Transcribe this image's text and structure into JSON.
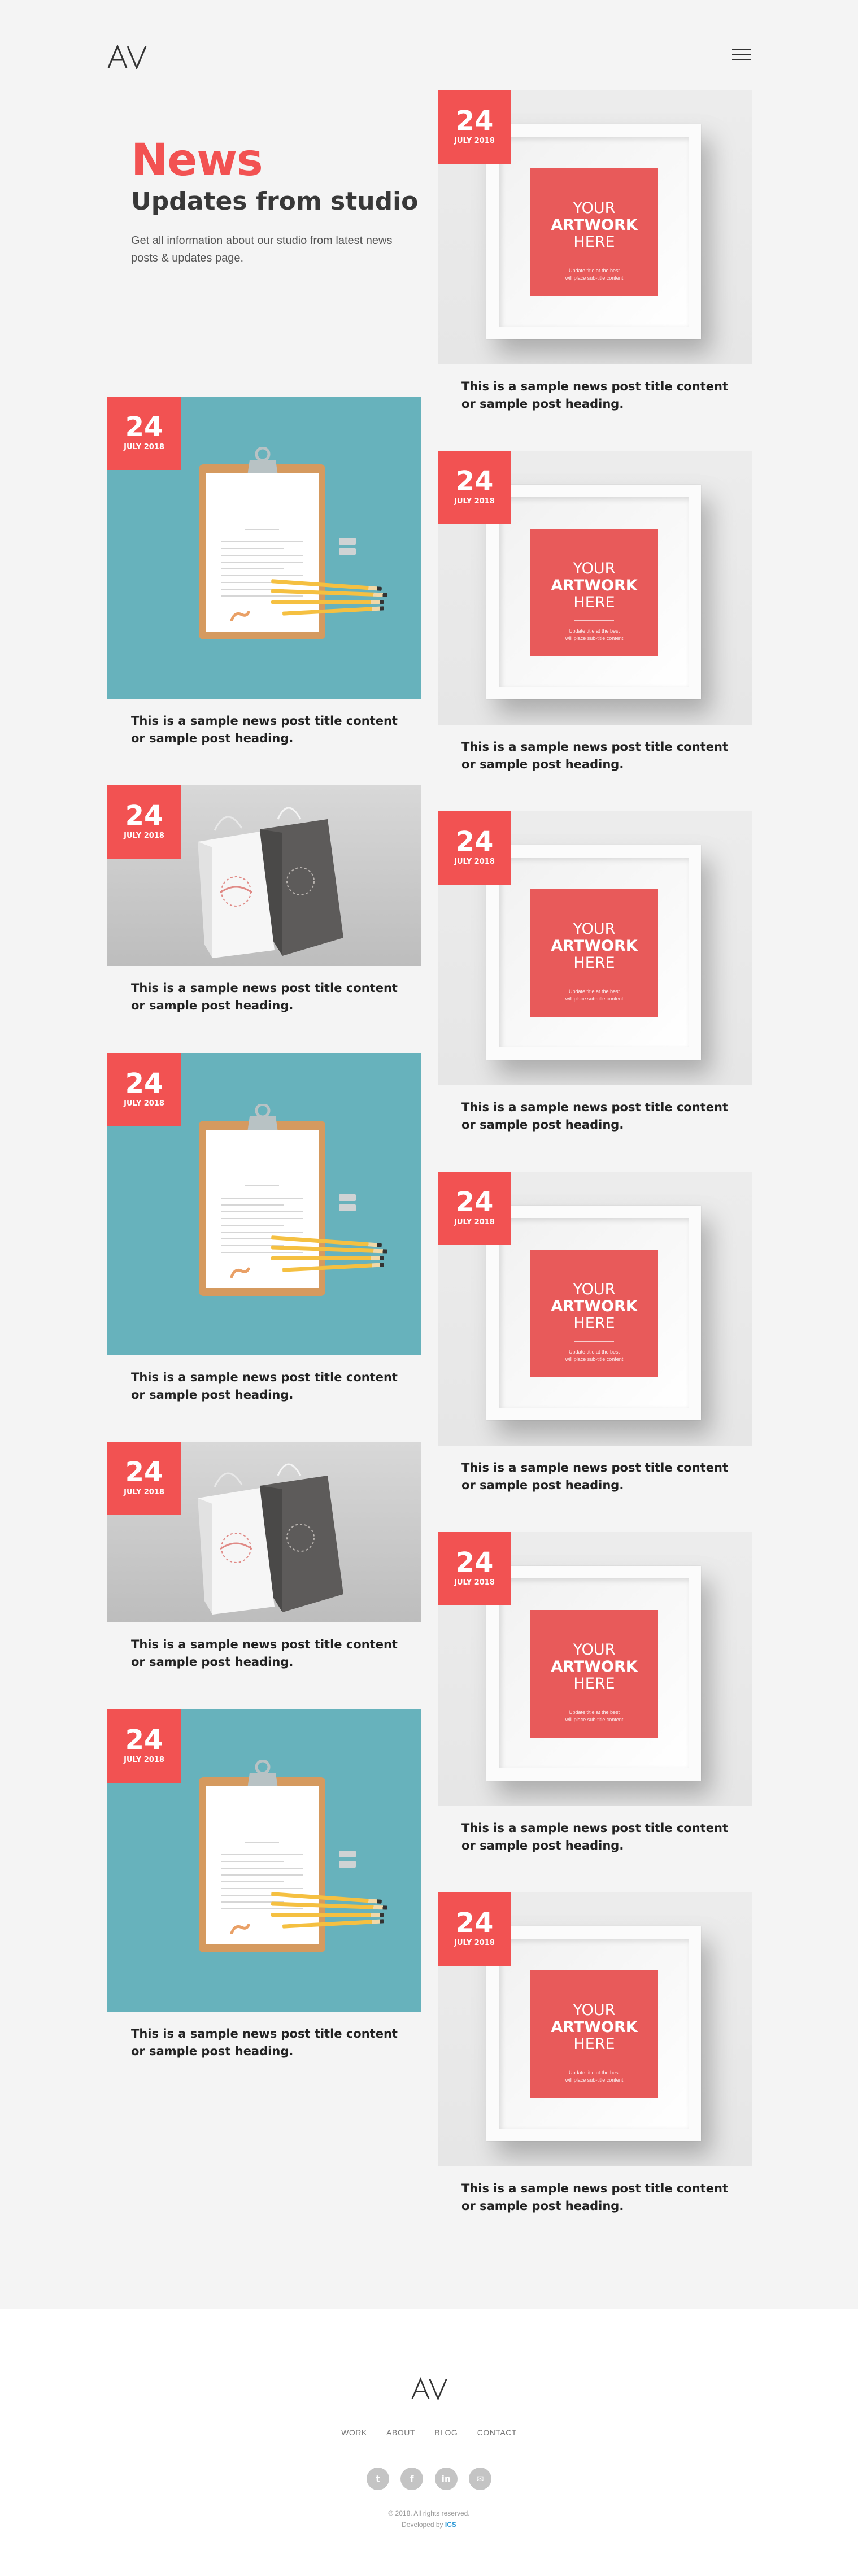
{
  "header": {
    "logo_icon": "av-logo",
    "menu_icon": "hamburger-icon"
  },
  "intro": {
    "title": "News",
    "subtitle": "Updates from studio",
    "description": "Get all information about our studio from latest news posts & updates page."
  },
  "post_title": "This is a sample news post title content or sample post heading.",
  "date": {
    "day": "24",
    "month": "JULY 2018"
  },
  "artwork": {
    "line1": "YOUR",
    "line2": "ARTWORK",
    "line3": "HERE",
    "small1": "Update title at the best",
    "small2": "will place sub-title content"
  },
  "colors": {
    "accent": "#f25252",
    "clipboard_bg": "#67b2bc",
    "artwork_red": "#e85a5a"
  },
  "footer": {
    "nav": [
      "WORK",
      "ABOUT",
      "BLOG",
      "CONTACT"
    ],
    "socials": [
      {
        "icon": "twitter-icon",
        "glyph": "t"
      },
      {
        "icon": "facebook-icon",
        "glyph": "f"
      },
      {
        "icon": "linkedin-icon",
        "glyph": "in"
      },
      {
        "icon": "email-icon",
        "glyph": "✉"
      }
    ],
    "copyright": "© 2018. All rights reserved.",
    "developed_prefix": "Developed by",
    "developed_mark": "ICS"
  }
}
